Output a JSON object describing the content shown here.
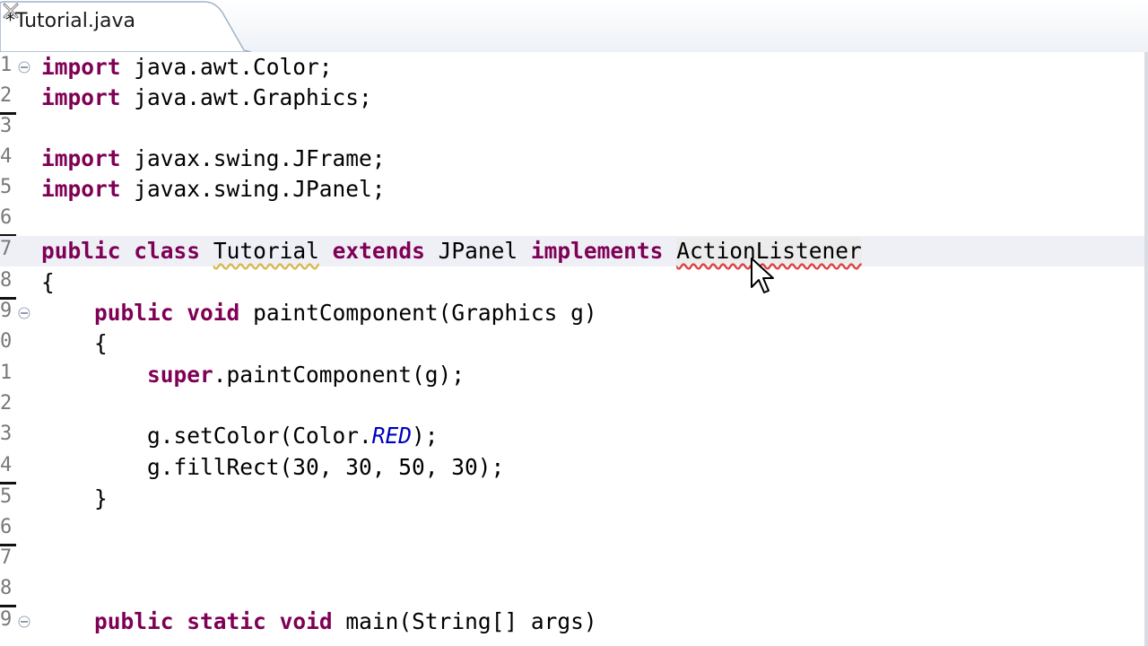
{
  "tab": {
    "title": "*Tutorial.java"
  },
  "gutter": {
    "numbers": [
      "1",
      "2",
      "3",
      "4",
      "5",
      "6",
      "7",
      "8",
      "9",
      "0",
      "1",
      "2",
      "3",
      "4",
      "5",
      "6",
      "7",
      "8",
      "9"
    ]
  },
  "code": {
    "l1": {
      "kw": "import",
      "rest": " java.awt.Color;"
    },
    "l2": {
      "kw": "import",
      "rest": " java.awt.Graphics;"
    },
    "l4": {
      "kw": "import",
      "rest": " javax.swing.JFrame;"
    },
    "l5": {
      "kw": "import",
      "rest": " javax.swing.JPanel;"
    },
    "l7": {
      "kw1": "public",
      "kw2": "class",
      "cls": "Tutorial",
      "kw3": "extends",
      "sup": "JPanel",
      "kw4": "implements",
      "iface": "ActionListener"
    },
    "l8": {
      "text": "{"
    },
    "l9": {
      "kw1": "public",
      "kw2": "void",
      "rest": " paintComponent(Graphics g)"
    },
    "l10": {
      "text": "    {"
    },
    "l11": {
      "kw": "super",
      "rest": ".paintComponent(g);"
    },
    "l13": {
      "pre": "g.setColor(Color.",
      "it": "RED",
      "post": ");"
    },
    "l14": {
      "text": "g.fillRect(30, 30, 50, 30);"
    },
    "l15": {
      "text": "    }"
    },
    "l19": {
      "kw1": "public",
      "kw2": "static",
      "kw3": "void",
      "rest": " main(String[] args)"
    }
  },
  "colors": {
    "keyword": "#7f0055",
    "constant": "#0000c0",
    "error_underline": "#e04040",
    "warning_underline": "#d9b84d"
  }
}
